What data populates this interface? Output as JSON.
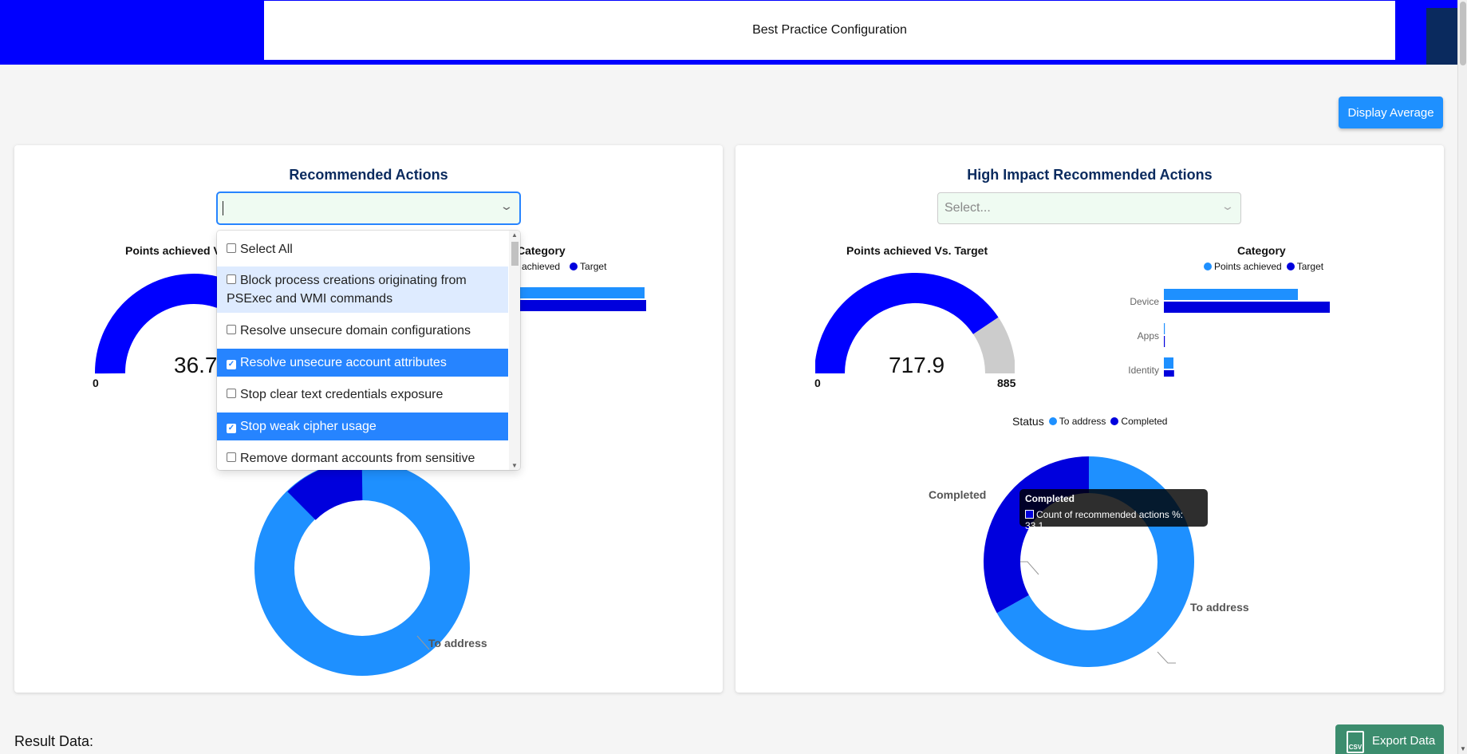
{
  "header": {
    "title": "Best Practice Configuration"
  },
  "toolbar": {
    "display_average_label": "Display Average",
    "export_label": "Export Data",
    "export_icon_text": "CSV"
  },
  "result": {
    "label": "Result Data:"
  },
  "colors": {
    "accent": "#0000ff",
    "light_blue": "#1e90ff",
    "dark_blue": "#0000dd",
    "gray": "#cccccc",
    "export_green": "#3c8d6e"
  },
  "left_card": {
    "title": "Recommended Actions",
    "select_value": "",
    "gauge_title_visible": "Points achieved V",
    "gauge_value_visible": "36.7",
    "gauge_min": "0",
    "category_title_visible": "Category",
    "category_legend_a_visible": "achieved",
    "category_legend_b": "Target",
    "donut_label": "To address",
    "menu": [
      {
        "label": "Select All",
        "checked": false
      },
      {
        "label": "Block process creations originating from PSExec and WMI commands",
        "checked": false
      },
      {
        "label": "Resolve unsecure domain configurations",
        "checked": false
      },
      {
        "label": "Resolve unsecure account attributes",
        "checked": true
      },
      {
        "label": "Stop clear text credentials exposure",
        "checked": false
      },
      {
        "label": "Stop weak cipher usage",
        "checked": true
      },
      {
        "label": "Remove dormant accounts from sensitive",
        "checked": false
      }
    ]
  },
  "right_card": {
    "title": "High Impact Recommended Actions",
    "select_placeholder": "Select...",
    "gauge_title": "Points achieved Vs. Target",
    "gauge_value": "717.9",
    "gauge_min": "0",
    "gauge_max": "885",
    "category_title": "Category",
    "legend_a": "Points achieved",
    "legend_b": "Target",
    "status_title": "Status",
    "status_legend_a": "To address",
    "status_legend_b": "Completed",
    "donut_label_completed": "Completed",
    "donut_label_to_address": "To address",
    "tooltip_title": "Completed",
    "tooltip_body": "Count of recommended actions %: 33.1"
  },
  "chart_data": [
    {
      "type": "gauge",
      "title": "Points achieved Vs. Target",
      "value": 717.9,
      "min": 0,
      "max": 885
    },
    {
      "type": "bar",
      "title": "Category",
      "orientation": "horizontal",
      "categories": [
        "Device",
        "Apps",
        "Identity"
      ],
      "series": [
        {
          "name": "Points achieved",
          "values": [
            420,
            3,
            30
          ]
        },
        {
          "name": "Target",
          "values": [
            520,
            3,
            32
          ]
        }
      ]
    },
    {
      "type": "pie",
      "title": "Status",
      "categories": [
        "To address",
        "Completed"
      ],
      "values": [
        66.9,
        33.1
      ]
    }
  ]
}
